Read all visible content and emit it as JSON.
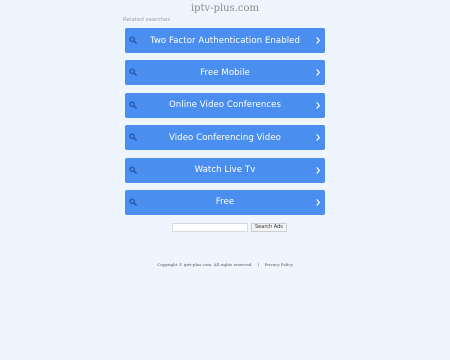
{
  "site": {
    "title": "iptv-plus.com"
  },
  "related_label": "Related searches",
  "items": [
    {
      "label": "Two Factor Authentication Enabled"
    },
    {
      "label": "Free Mobile"
    },
    {
      "label": "Online Video Conferences"
    },
    {
      "label": "Video Conferencing Video"
    },
    {
      "label": "Watch Live Tv"
    },
    {
      "label": "Free"
    }
  ],
  "search": {
    "value": "",
    "button_label": "Search Ads"
  },
  "footer": {
    "copyright": "Copyright © iptv-plus.com.  All rights reserved.",
    "separator": "|",
    "privacy": "Privacy Policy"
  },
  "colors": {
    "button": "#4a8ff0",
    "background": "#eef5fe"
  },
  "icons": {
    "left": "search-icon",
    "right": "chevron-right-icon"
  }
}
